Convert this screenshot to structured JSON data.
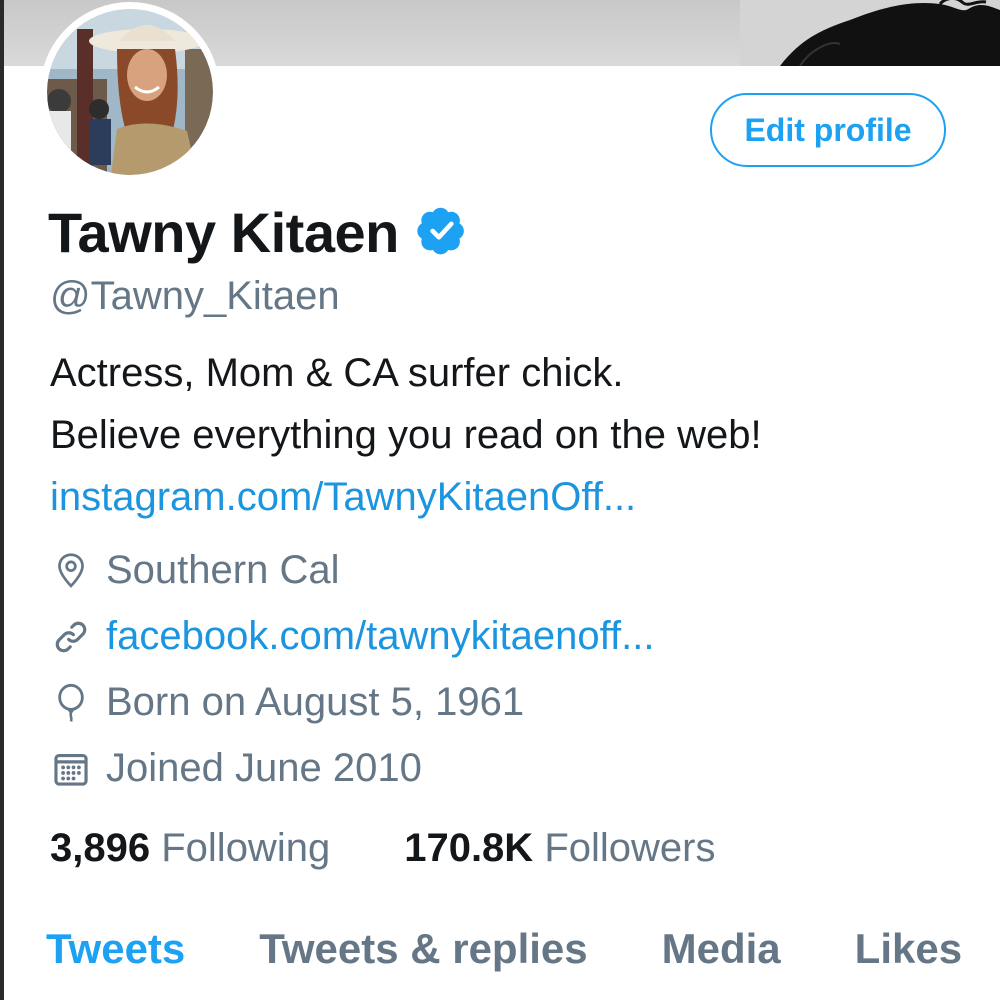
{
  "profile": {
    "name": "Tawny Kitaen",
    "handle": "@Tawny_Kitaen",
    "verified": true,
    "edit_button_label": "Edit profile",
    "bio_line1": "Actress, Mom & CA surfer chick.",
    "bio_line2": "Believe everything you read on the web!",
    "bio_link": "instagram.com/TawnyKitaenOff...",
    "location": "Southern Cal",
    "website": "facebook.com/tawnykitaenoff...",
    "birth": "Born on August 5, 1961",
    "joined": "Joined June 2010"
  },
  "stats": {
    "following_count": "3,896",
    "following_label": "Following",
    "followers_count": "170.8K",
    "followers_label": "Followers"
  },
  "tabs": [
    {
      "label": "Tweets",
      "active": true
    },
    {
      "label": "Tweets & replies",
      "active": false
    },
    {
      "label": "Media",
      "active": false
    },
    {
      "label": "Likes",
      "active": false
    }
  ],
  "icons": {
    "verified": "verified-badge-icon",
    "location": "location-pin-icon",
    "website": "link-icon",
    "birth": "balloon-icon",
    "joined": "calendar-icon"
  },
  "colors": {
    "accent": "#1da1f2",
    "link": "#1b95e0",
    "secondary_text": "#657786",
    "primary_text": "#14171a"
  }
}
